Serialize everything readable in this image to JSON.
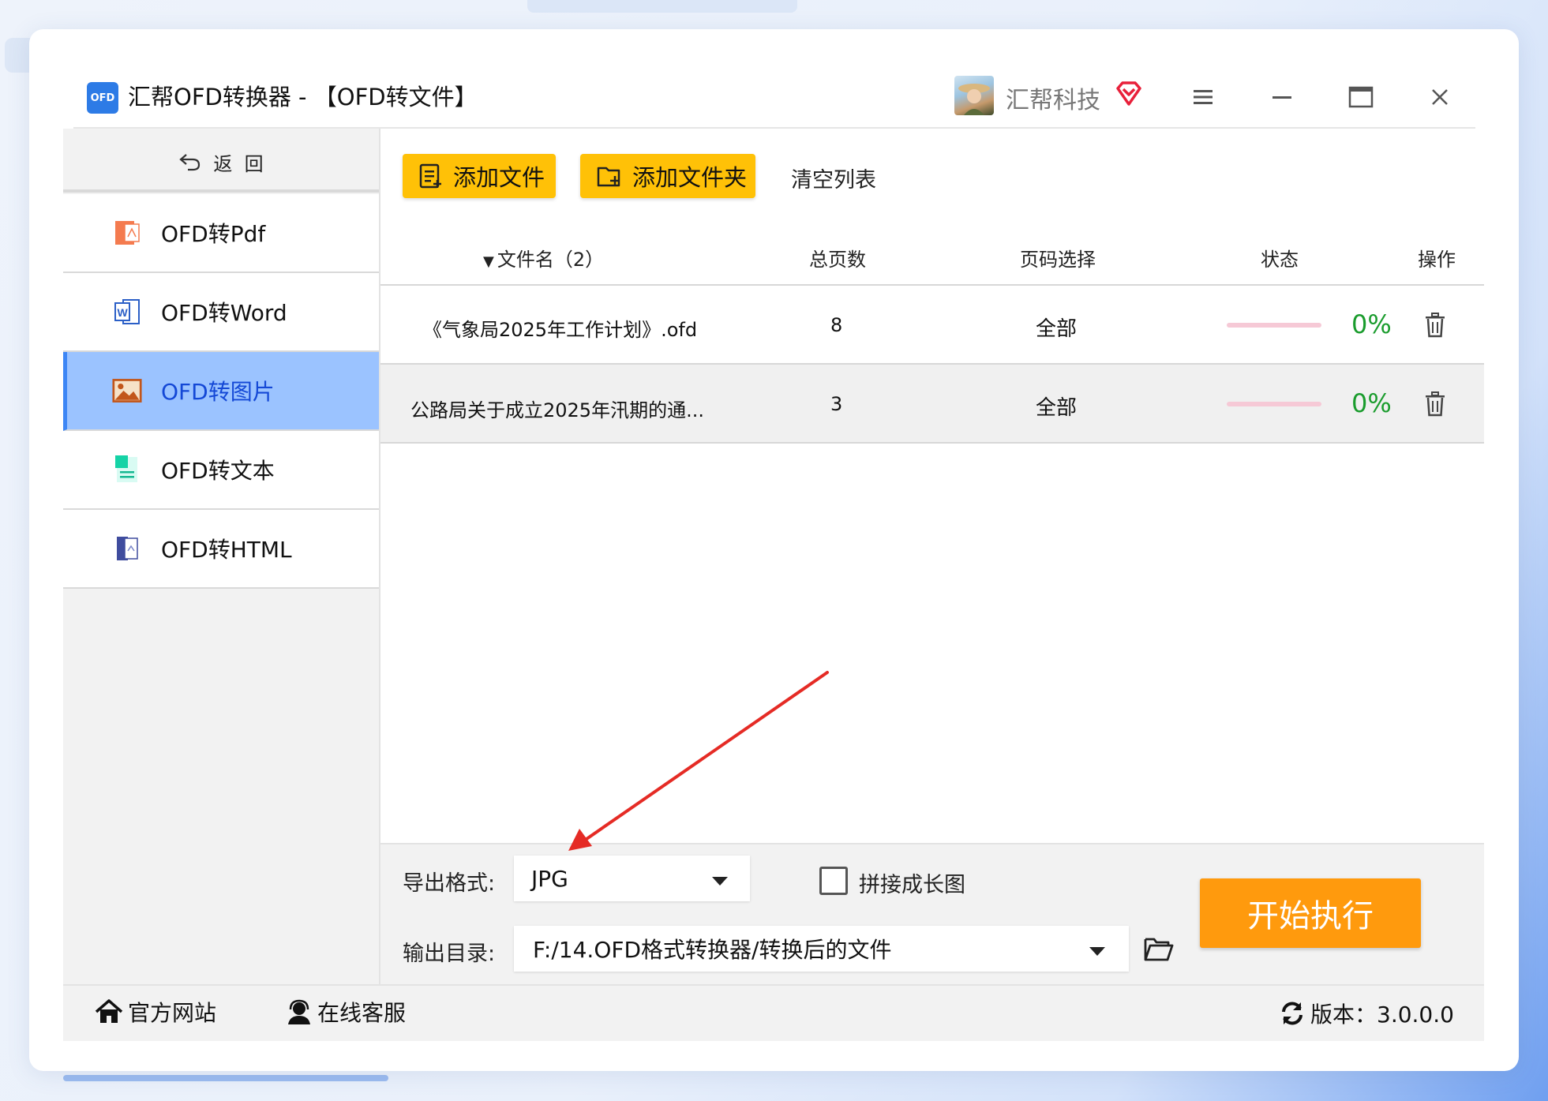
{
  "app": {
    "title": "汇帮OFD转换器 - 【OFD转文件】",
    "logo_text": "OFD",
    "user_name": "汇帮科技",
    "vip_icon": "vip-diamond-icon",
    "accent_color": "#ffc107",
    "start_color": "#ff9a0d"
  },
  "sidebar": {
    "back_label": "返  回",
    "items": [
      {
        "label": "OFD转Pdf",
        "icon": "pdf-file-icon"
      },
      {
        "label": "OFD转Word",
        "icon": "word-file-icon"
      },
      {
        "label": "OFD转图片",
        "icon": "image-icon"
      },
      {
        "label": "OFD转文本",
        "icon": "text-file-icon"
      },
      {
        "label": "OFD转HTML",
        "icon": "html-file-icon"
      }
    ],
    "active_index": 2
  },
  "toolbar": {
    "add_file": "添加文件",
    "add_folder": "添加文件夹",
    "clear_list": "清空列表"
  },
  "table": {
    "headers": [
      "文件名（2）",
      "总页数",
      "页码选择",
      "状态",
      "操作"
    ],
    "rows": [
      {
        "name": "《气象局2025年工作计划》.ofd",
        "pages": "8",
        "page_select": "全部",
        "progress_text": "0%",
        "progress": 0
      },
      {
        "name": "公路局关于成立2025年汛期的通...",
        "pages": "3",
        "page_select": "全部",
        "progress_text": "0%",
        "progress": 0
      }
    ]
  },
  "settings": {
    "format_label": "导出格式:",
    "format_value": "JPG",
    "stitch_label": "拼接成长图",
    "stitch_checked": false,
    "output_label": "输出目录:",
    "output_value": "F:/14.OFD格式转换器/转换后的文件",
    "start_label": "开始执行"
  },
  "footer": {
    "website": "官方网站",
    "support": "在线客服",
    "version": "版本：3.0.0.0"
  }
}
